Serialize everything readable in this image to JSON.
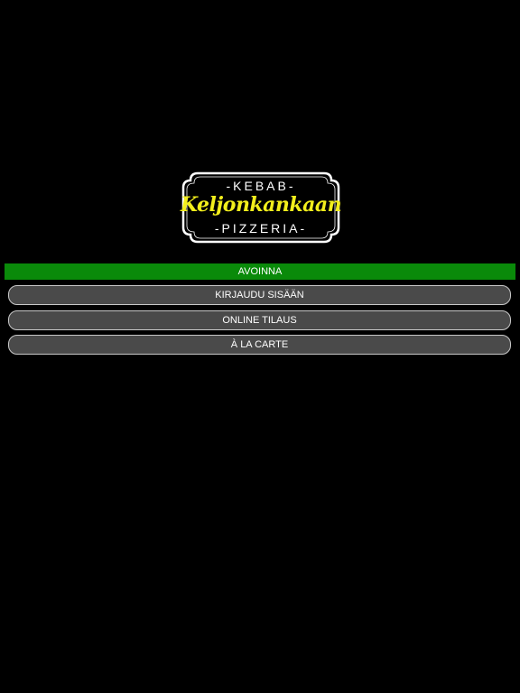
{
  "logo": {
    "top_text": "-KEBAB-",
    "name": "Keljonkankaan",
    "bottom_text": "-PIZZERIA-"
  },
  "status": {
    "label": "AVOINNA",
    "color": "#0a8a0a"
  },
  "menu": {
    "login_label": "KIRJAUDU SISÄÄN",
    "online_order_label": "ONLINE TILAUS",
    "a_la_carte_label": "À LA CARTE"
  }
}
